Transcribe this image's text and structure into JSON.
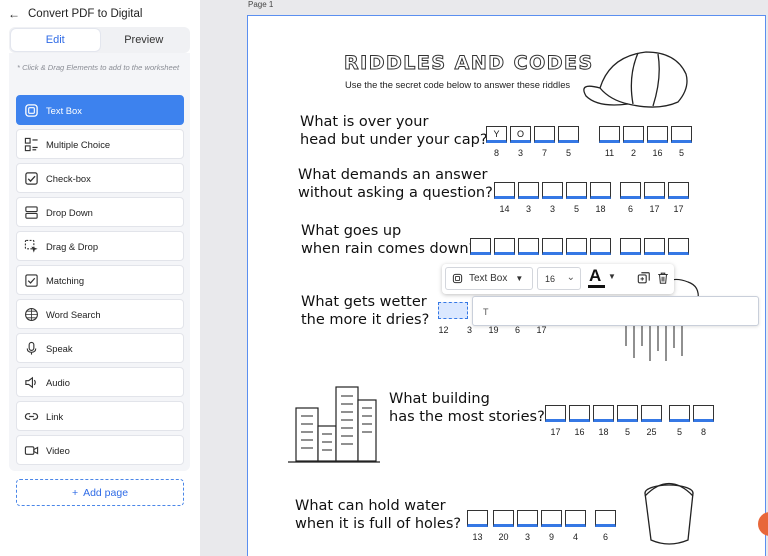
{
  "header": {
    "back_label": "←",
    "title": "Convert PDF to Digital"
  },
  "tabs": [
    {
      "label": "Edit",
      "active": true
    },
    {
      "label": "Preview",
      "active": false
    }
  ],
  "hint": "* Click & Drag Elements to add to the worksheet",
  "elements": [
    {
      "label": "Text Box",
      "icon": "text-box-icon",
      "active": true
    },
    {
      "label": "Multiple Choice",
      "icon": "multiple-choice-icon",
      "active": false
    },
    {
      "label": "Check-box",
      "icon": "checkbox-icon",
      "active": false
    },
    {
      "label": "Drop Down",
      "icon": "drop-down-icon",
      "active": false
    },
    {
      "label": "Drag & Drop",
      "icon": "drag-drop-icon",
      "active": false
    },
    {
      "label": "Matching",
      "icon": "matching-icon",
      "active": false
    },
    {
      "label": "Word Search",
      "icon": "word-search-icon",
      "active": false
    },
    {
      "label": "Speak",
      "icon": "microphone-icon",
      "active": false
    },
    {
      "label": "Audio",
      "icon": "speaker-icon",
      "active": false
    },
    {
      "label": "Link",
      "icon": "link-icon",
      "active": false
    },
    {
      "label": "Video",
      "icon": "video-icon",
      "active": false
    }
  ],
  "add_page": {
    "plus": "+",
    "label": "Add page"
  },
  "page": {
    "label": "Page 1",
    "title": "RIDDLES AND CODES",
    "subtitle": "Use the the secret code below to answer these riddles",
    "riddles": [
      {
        "lines": [
          "What is over your",
          "head but under your cap?"
        ],
        "codes": [
          "8",
          "3",
          "7",
          "5",
          "11",
          "2",
          "16",
          "5"
        ],
        "filled": [
          "Y",
          "O"
        ]
      },
      {
        "lines": [
          "What demands an answer",
          "without asking a question?"
        ],
        "codes": [
          "14",
          "3",
          "3",
          "5",
          "18",
          "6",
          "17",
          "17"
        ]
      },
      {
        "lines": [
          "What goes up",
          "when rain comes down?"
        ],
        "codes": []
      },
      {
        "lines": [
          "What gets wetter",
          "the more it dries?"
        ],
        "codes": [
          "12",
          "3",
          "19",
          "6",
          "17"
        ]
      },
      {
        "lines": [
          "What building",
          "has the most stories?"
        ],
        "codes": [
          "17",
          "16",
          "18",
          "5",
          "25",
          "5",
          "8"
        ]
      },
      {
        "lines": [
          "What can hold water",
          "when it is full of holes?"
        ],
        "codes": [
          "13",
          "20",
          "3",
          "9",
          "4",
          "6"
        ]
      }
    ]
  },
  "toolbar": {
    "element_type": "Text Box",
    "font_size": "16",
    "color_letter": "A"
  },
  "textbox_value": "T",
  "colors": {
    "accent": "#3d82ee",
    "page_border": "#5b8ff0",
    "box_underline": "#3578e5"
  }
}
